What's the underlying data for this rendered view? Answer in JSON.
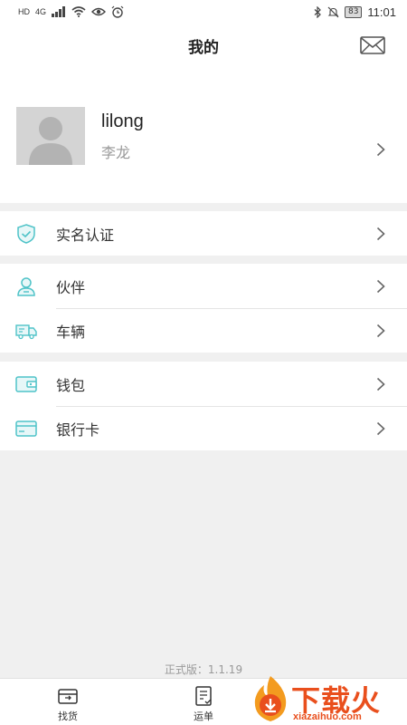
{
  "status_bar": {
    "left_text": "HD",
    "signal_text": "4G",
    "battery": "83",
    "time": "11:01"
  },
  "header": {
    "title": "我的",
    "mail_icon": "mail-icon"
  },
  "profile": {
    "username": "lilong",
    "real_name": "李龙",
    "avatar_icon": "avatar-placeholder"
  },
  "menu": {
    "verify": {
      "label": "实名认证",
      "icon": "shield-check-icon"
    },
    "partner": {
      "label": "伙伴",
      "icon": "person-icon"
    },
    "vehicle": {
      "label": "车辆",
      "icon": "truck-icon"
    },
    "wallet": {
      "label": "钱包",
      "icon": "wallet-icon"
    },
    "bank_card": {
      "label": "银行卡",
      "icon": "bank-card-icon"
    }
  },
  "version_text": "正式版：1.1.19",
  "bottom_nav": {
    "find_goods": {
      "label": "找货",
      "icon": "find-goods-icon"
    },
    "waybill": {
      "label": "运单",
      "icon": "waybill-icon"
    }
  },
  "watermark": {
    "text": "下载火",
    "url": "xiazaihuo.com"
  },
  "colors": {
    "accent": "#4fc3c8",
    "chevron": "#555555",
    "watermark": "#e94f1d"
  }
}
